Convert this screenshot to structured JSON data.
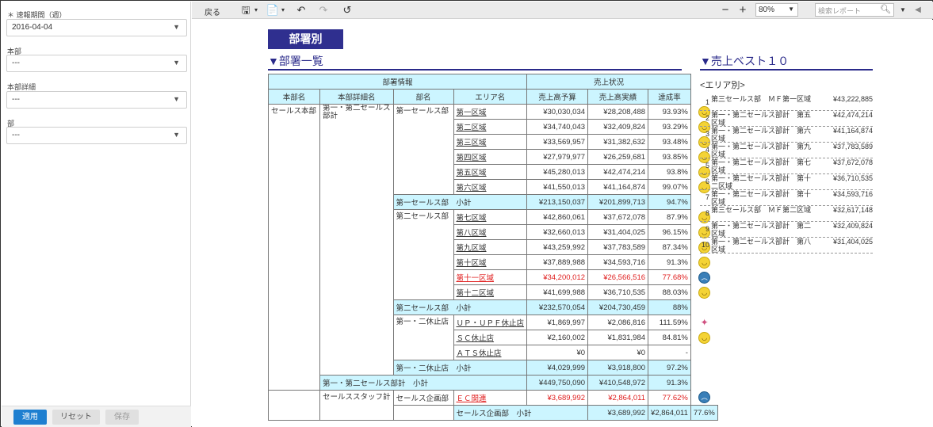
{
  "filters": {
    "period_label": "＊ 速報期間（週）",
    "period_value": "2016-04-04",
    "honbu_label": "本部",
    "honbu_value": "---",
    "honbu_detail_label": "本部詳細",
    "honbu_detail_value": "---",
    "bu_label": "部",
    "bu_value": "---"
  },
  "buttons": {
    "apply": "適用",
    "reset": "リセット",
    "save": "保存"
  },
  "toolbar": {
    "back": "戻る",
    "zoom": "80%",
    "search_placeholder": "検索レポート"
  },
  "page": {
    "title": "部署別",
    "dept_list_heading": "▼部署一覧",
    "best10_heading": "▼売上ベスト１０",
    "area_heading": "<エリア別>"
  },
  "table": {
    "group_headers": [
      "部署情報",
      "売上状況"
    ],
    "columns": [
      "本部名",
      "本部詳細名",
      "部名",
      "エリア名",
      "売上高予算",
      "売上高実績",
      "達成率"
    ],
    "honbu1": "セールス本部",
    "detail1": "第一・第二セールス部計",
    "bu1": "第一セールス部",
    "bu2": "第二セールス部",
    "bu3": "第一・二休止店",
    "honbu2": "セールススタッフ計",
    "bu4": "セールス企画部",
    "rows1": [
      {
        "area": "第一区域",
        "budget": "¥30,030,034",
        "actual": "¥28,208,488",
        "rate": "93.93%",
        "icon": "smile"
      },
      {
        "area": "第二区域",
        "budget": "¥34,740,043",
        "actual": "¥32,409,824",
        "rate": "93.29%",
        "icon": "smile"
      },
      {
        "area": "第三区域",
        "budget": "¥33,569,957",
        "actual": "¥31,382,632",
        "rate": "93.48%",
        "icon": "smile"
      },
      {
        "area": "第四区域",
        "budget": "¥27,979,977",
        "actual": "¥26,259,681",
        "rate": "93.85%",
        "icon": "smile"
      },
      {
        "area": "第五区域",
        "budget": "¥45,280,013",
        "actual": "¥42,474,214",
        "rate": "93.8%",
        "icon": "smile"
      },
      {
        "area": "第六区域",
        "budget": "¥41,550,013",
        "actual": "¥41,164,874",
        "rate": "99.07%",
        "icon": "smile"
      }
    ],
    "sub1": {
      "label": "第一セールス部　小計",
      "budget": "¥213,150,037",
      "actual": "¥201,899,713",
      "rate": "94.7%"
    },
    "rows2": [
      {
        "area": "第七区域",
        "budget": "¥42,860,061",
        "actual": "¥37,672,078",
        "rate": "87.9%",
        "icon": "smile"
      },
      {
        "area": "第八区域",
        "budget": "¥32,660,013",
        "actual": "¥31,404,025",
        "rate": "96.15%",
        "icon": "smile"
      },
      {
        "area": "第九区域",
        "budget": "¥43,259,992",
        "actual": "¥37,783,589",
        "rate": "87.34%",
        "icon": "smile"
      },
      {
        "area": "第十区域",
        "budget": "¥37,889,988",
        "actual": "¥34,593,716",
        "rate": "91.3%",
        "icon": "smile"
      },
      {
        "area": "第十一区域",
        "budget": "¥34,200,012",
        "actual": "¥26,566,516",
        "rate": "77.68%",
        "icon": "sad",
        "red": true
      },
      {
        "area": "第十二区域",
        "budget": "¥41,699,988",
        "actual": "¥36,710,535",
        "rate": "88.03%",
        "icon": "smile"
      }
    ],
    "sub2": {
      "label": "第二セールス部　小計",
      "budget": "¥232,570,054",
      "actual": "¥204,730,459",
      "rate": "88%"
    },
    "rows3": [
      {
        "area": "ＵＰ・ＵＰＦ休止店",
        "budget": "¥1,869,997",
        "actual": "¥2,086,816",
        "rate": "111.59%",
        "icon": "party"
      },
      {
        "area": "ＳＣ休止店",
        "budget": "¥2,160,002",
        "actual": "¥1,831,984",
        "rate": "84.81%",
        "icon": "smile"
      },
      {
        "area": "ＡＴＳ休止店",
        "budget": "¥0",
        "actual": "¥0",
        "rate": "-",
        "icon": ""
      }
    ],
    "sub3": {
      "label": "第一・二休止店　小計",
      "budget": "¥4,029,999",
      "actual": "¥3,918,800",
      "rate": "97.2%"
    },
    "sub4": {
      "label": "第一・第二セールス部計　小計",
      "budget": "¥449,750,090",
      "actual": "¥410,548,972",
      "rate": "91.3%"
    },
    "row4": {
      "area": "ＥＣ関連",
      "budget": "¥3,689,992",
      "actual": "¥2,864,011",
      "rate": "77.62%",
      "icon": "sad",
      "red": true
    },
    "sub5": {
      "label": "セールス企画部　小計",
      "budget": "¥3,689,992",
      "actual": "¥2,864,011",
      "rate": "77.6%"
    }
  },
  "ranking": [
    {
      "rank": "1",
      "name": "第三セールス部　ＭＦ第一区域",
      "value": "¥43,222,885"
    },
    {
      "rank": "2",
      "name": "第一・第二セールス部計　第五区域",
      "value": "¥42,474,214"
    },
    {
      "rank": "3",
      "name": "第一・第二セールス部計　第六区域",
      "value": "¥41,164,874"
    },
    {
      "rank": "4",
      "name": "第一・第二セールス部計　第九区域",
      "value": "¥37,783,589"
    },
    {
      "rank": "5",
      "name": "第一・第二セールス部計　第七区域",
      "value": "¥37,672,078"
    },
    {
      "rank": "6",
      "name": "第一・第二セールス部計　第十二区域",
      "value": "¥36,710,535"
    },
    {
      "rank": "7",
      "name": "第一・第二セールス部計　第十区域",
      "value": "¥34,593,716"
    },
    {
      "rank": "8",
      "name": "第三セールス部　ＭＦ第二区域",
      "value": "¥32,617,148"
    },
    {
      "rank": "9",
      "name": "第一・第二セールス部計　第二区域",
      "value": "¥32,409,824"
    },
    {
      "rank": "10",
      "name": "第一・第二セールス部計　第八区域",
      "value": "¥31,404,025"
    }
  ],
  "colors": {
    "accent": "#2f2f8f",
    "header_bg": "#ccf5ff",
    "apply_btn": "#1e7fd0",
    "alert": "#e02020"
  }
}
